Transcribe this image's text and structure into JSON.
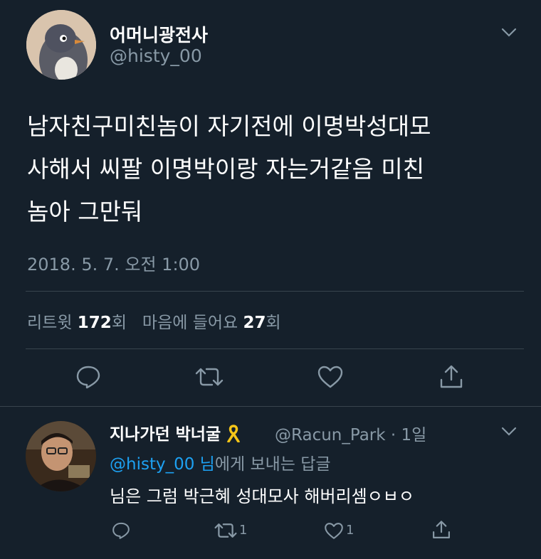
{
  "tweet": {
    "display_name": "어머니광전사",
    "handle": "@histy_00",
    "text_lines": [
      "남자친구미친놈이 자기전에 이명박성대모",
      "사해서 씨팔 이명박이랑 자는거같음 미친",
      "놈아 그만둬"
    ],
    "timestamp": "2018. 5. 7. 오전 1:00",
    "stats": {
      "retweet_label": "리트윗",
      "retweet_count": "172",
      "retweet_unit": "회",
      "like_label": "마음에 들어요",
      "like_count": "27",
      "like_unit": "회"
    }
  },
  "reply": {
    "display_name": "지나가던 박너굴",
    "ribbon_emoji": "🎗",
    "handle_time": "@Racun_Park · 1일",
    "replying_link": "@histy_00 님",
    "replying_suffix": "에게 보내는 답글",
    "text": "님은 그럼 박근혜 성대모사 해버리셈ㅇㅂㅇ",
    "retweet_count": "1",
    "like_count": "1"
  },
  "colors": {
    "background": "#15202b",
    "muted": "#8899a6",
    "link": "#1da1f2",
    "divider": "#38444d",
    "ribbon": "#f5c518"
  },
  "icons": [
    "penguin-avatar",
    "chevron-down-icon",
    "reply-icon",
    "retweet-icon",
    "heart-icon",
    "share-icon",
    "yellow-ribbon-icon"
  ]
}
